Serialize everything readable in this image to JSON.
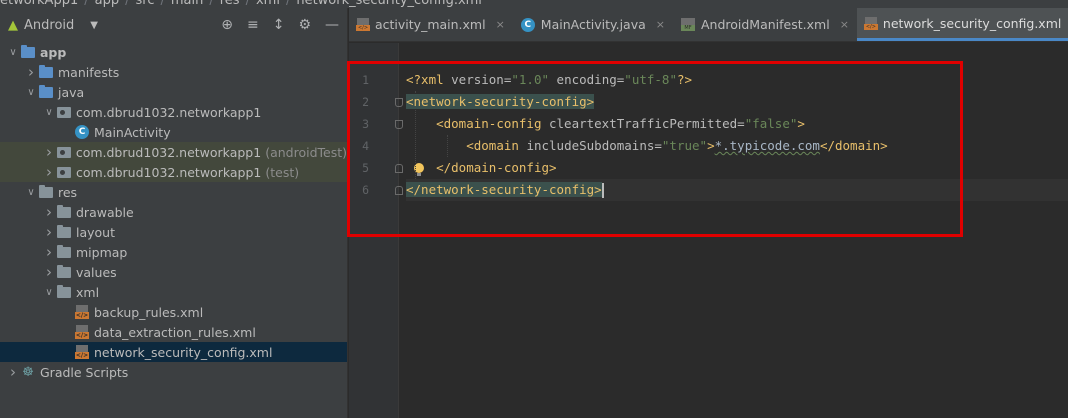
{
  "breadcrumb": [
    "etworkApp1",
    "app",
    "src",
    "main",
    "res",
    "xml",
    "network_security_config.xml"
  ],
  "project_panel": {
    "view_selector": "Android",
    "tool_icons": [
      "crosshair-icon",
      "collapse-all-icon",
      "expand-all-icon",
      "gear-icon",
      "minimize-icon"
    ],
    "tree": [
      {
        "label": "app",
        "depth": 0,
        "arrow": "down",
        "icon": "app-module",
        "bold": true
      },
      {
        "label": "manifests",
        "depth": 1,
        "arrow": "right",
        "icon": "folder-blue"
      },
      {
        "label": "java",
        "depth": 1,
        "arrow": "down",
        "icon": "folder-blue"
      },
      {
        "label": "com.dbrud1032.networkapp1",
        "depth": 2,
        "arrow": "down",
        "icon": "package"
      },
      {
        "label": "MainActivity",
        "depth": 3,
        "arrow": "",
        "icon": "class"
      },
      {
        "label": "com.dbrud1032.networkapp1",
        "suffix": "(androidTest)",
        "depth": 2,
        "arrow": "right",
        "icon": "package",
        "highlight": true
      },
      {
        "label": "com.dbrud1032.networkapp1",
        "suffix": "(test)",
        "depth": 2,
        "arrow": "right",
        "icon": "package",
        "highlight": true
      },
      {
        "label": "res",
        "depth": 1,
        "arrow": "down",
        "icon": "folder"
      },
      {
        "label": "drawable",
        "depth": 2,
        "arrow": "right",
        "icon": "folder"
      },
      {
        "label": "layout",
        "depth": 2,
        "arrow": "right",
        "icon": "folder"
      },
      {
        "label": "mipmap",
        "depth": 2,
        "arrow": "right",
        "icon": "folder"
      },
      {
        "label": "values",
        "depth": 2,
        "arrow": "right",
        "icon": "folder"
      },
      {
        "label": "xml",
        "depth": 2,
        "arrow": "down",
        "icon": "folder"
      },
      {
        "label": "backup_rules.xml",
        "depth": 3,
        "arrow": "",
        "icon": "xml"
      },
      {
        "label": "data_extraction_rules.xml",
        "depth": 3,
        "arrow": "",
        "icon": "xml"
      },
      {
        "label": "network_security_config.xml",
        "depth": 3,
        "arrow": "",
        "icon": "xml",
        "selected": true
      },
      {
        "label": "Gradle Scripts",
        "depth": 0,
        "arrow": "right",
        "icon": "gradle"
      }
    ]
  },
  "editor": {
    "tabs": [
      {
        "label": "activity_main.xml",
        "icon": "xml",
        "active": false
      },
      {
        "label": "MainActivity.java",
        "icon": "class",
        "active": false
      },
      {
        "label": "AndroidManifest.xml",
        "icon": "manifest",
        "active": false
      },
      {
        "label": "network_security_config.xml",
        "icon": "xml",
        "active": true
      }
    ],
    "line_numbers": [
      "1",
      "2",
      "3",
      "4",
      "5",
      "6"
    ],
    "code": {
      "l1": {
        "a": "<?xml ",
        "b": "version",
        "c": "=",
        "d": "\"1.0\"",
        "e": " ",
        "f": "encoding",
        "g": "=",
        "h": "\"utf-8\"",
        "i": "?>"
      },
      "l2": {
        "a": "<network-security-config>"
      },
      "l3": {
        "indent": "    ",
        "a": "<domain-config ",
        "b": "cleartextTrafficPermitted",
        "c": "=",
        "d": "\"false\"",
        "e": ">"
      },
      "l4": {
        "indent": "        ",
        "a": "<domain ",
        "b": "includeSubdomains",
        "c": "=",
        "d": "\"true\"",
        "e": ">",
        "f": "*.typicode.com",
        "g": "</domain>"
      },
      "l5": {
        "indent": "    ",
        "a": "</domain-config>"
      },
      "l6": {
        "a": "</network-security-config>"
      }
    }
  },
  "colors": {
    "annotation_box": "#e00000",
    "accent": "#4a88c7"
  }
}
